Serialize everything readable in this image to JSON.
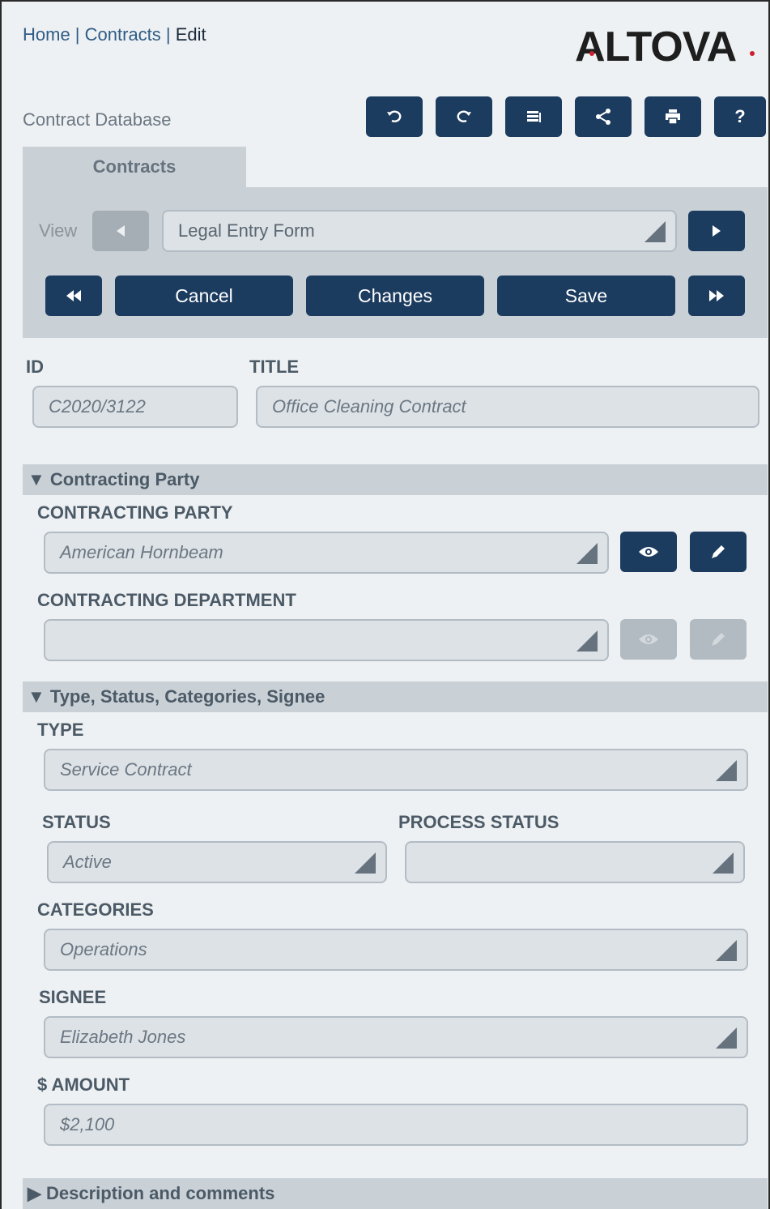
{
  "breadcrumb": {
    "home": "Home",
    "sep1": " | ",
    "contracts": "Contracts",
    "sep2": " | ",
    "current": "Edit"
  },
  "logo": {
    "text_a": "A",
    "text_l": "LTOV",
    "text_end": "A"
  },
  "db_title": "Contract Database",
  "toolbar": {
    "undo_icon": "undo-icon",
    "redo_icon": "redo-icon",
    "list_icon": "list-icon",
    "share_icon": "share-icon",
    "print_icon": "print-icon",
    "help": "?"
  },
  "tab": {
    "label": "Contracts"
  },
  "view": {
    "label": "View",
    "selected": "Legal Entry Form"
  },
  "actions": {
    "cancel": "Cancel",
    "changes": "Changes",
    "save": "Save"
  },
  "form": {
    "id": {
      "label": "ID",
      "value": "C2020/3122"
    },
    "title": {
      "label": "TITLE",
      "value": "Office Cleaning Contract"
    },
    "section_party": "▼ Contracting Party",
    "contracting_party": {
      "label": "CONTRACTING PARTY",
      "value": "American Hornbeam"
    },
    "contracting_department": {
      "label": "CONTRACTING DEPARTMENT",
      "value": ""
    },
    "section_type": "▼ Type, Status, Categories, Signee",
    "type": {
      "label": "TYPE",
      "value": "Service Contract"
    },
    "status": {
      "label": "STATUS",
      "value": "Active"
    },
    "process_status": {
      "label": "PROCESS STATUS",
      "value": ""
    },
    "categories": {
      "label": "CATEGORIES",
      "value": "Operations"
    },
    "signee": {
      "label": "SIGNEE",
      "value": "Elizabeth Jones"
    },
    "amount": {
      "label": "$ AMOUNT",
      "value": "$2,100"
    },
    "section_description": "▶ Description and comments"
  },
  "colors": {
    "primary": "#1b3b5f",
    "panel": "#c9d0d6",
    "background": "#eef1f3",
    "logo_accent": "#cc1f2f"
  }
}
